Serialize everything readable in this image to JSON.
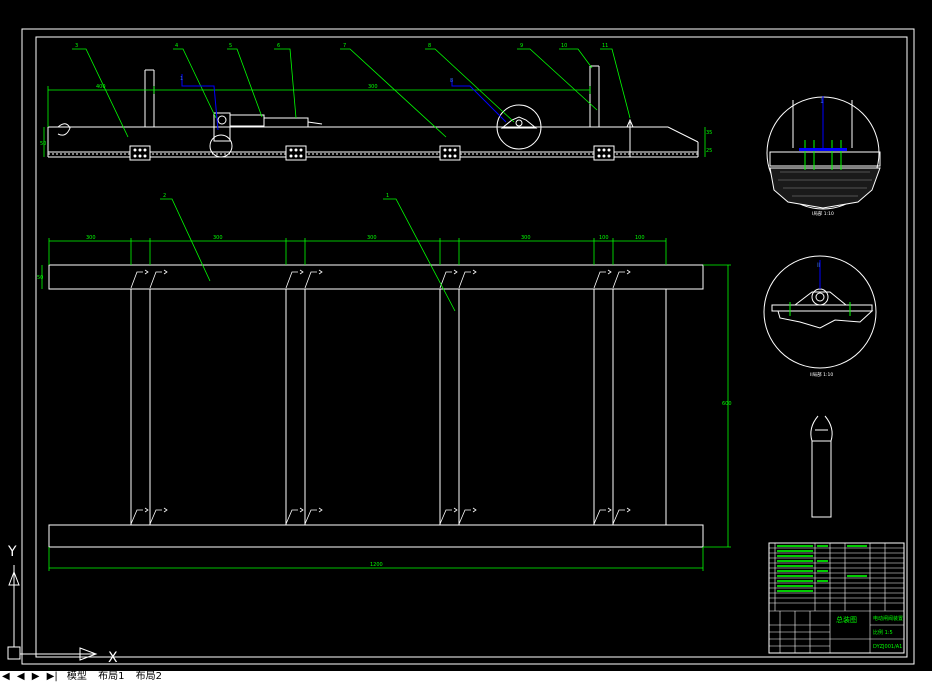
{
  "colors": {
    "background": "#000000",
    "line": "#ffffff",
    "leader": "#00ff00",
    "annotation_blue": "#0000ff",
    "title_text": "#00ff00"
  },
  "elevation": {
    "balloons": [
      "3",
      "4",
      "5",
      "6",
      "7",
      "8",
      "9",
      "10",
      "11"
    ],
    "blue_balloons": [
      "1",
      "8"
    ],
    "dims_top": [
      "400",
      "300"
    ],
    "dims_side": [
      "50",
      "35",
      "25"
    ]
  },
  "plan": {
    "balloons": [
      "2",
      "1"
    ],
    "dims_top": [
      "300",
      "300",
      "300",
      "300",
      "100",
      "100"
    ],
    "dim_bottom": "1200",
    "dim_right": "600",
    "dim_left": "50"
  },
  "details": {
    "detail1_label": "1",
    "detail1_caption": "I局部 1:10",
    "detail2_label": "II",
    "detail2_caption": "II局部 1:10"
  },
  "title_block": {
    "drawing_name": "总装图",
    "company": "电动闸阀装置",
    "scale": "比例 1:5",
    "drawing_no": "DYZJ001/A1"
  },
  "ucs": {
    "x_label": "X",
    "y_label": "Y"
  },
  "tabs": {
    "nav": [
      "◀",
      "◀",
      "▶",
      "▶|"
    ],
    "items": [
      "模型",
      "布局1",
      "布局2"
    ]
  }
}
